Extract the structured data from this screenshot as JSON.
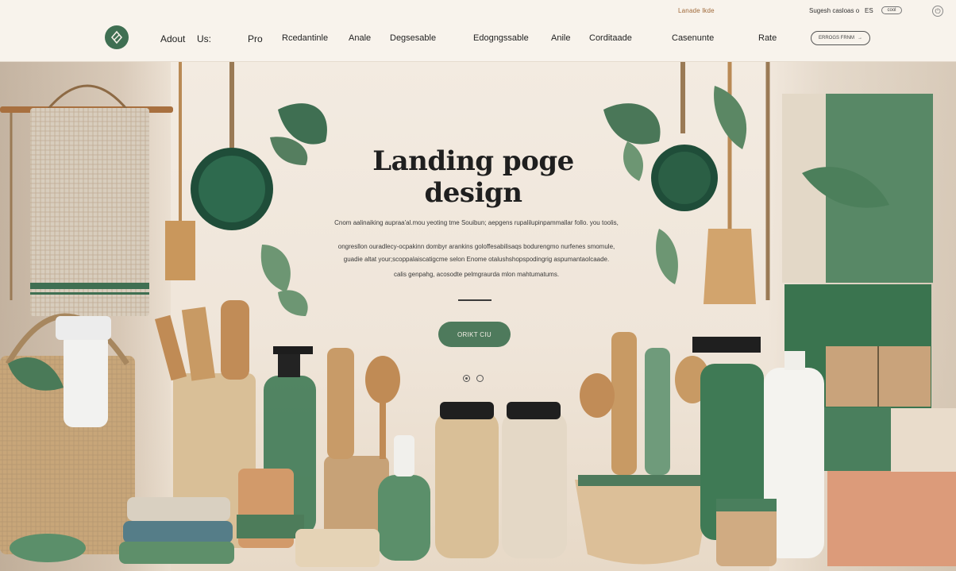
{
  "topbar": {
    "link": "Lanade lkde",
    "suggest": "Sugesh  casloas  o",
    "lang": "ES",
    "pill": "cool"
  },
  "nav": {
    "items": [
      {
        "label": "Adout"
      },
      {
        "label": "Us:"
      },
      {
        "label": "Pro"
      },
      {
        "label": "Rcedantinle"
      },
      {
        "label": "Anale"
      },
      {
        "label": "Degsesable"
      },
      {
        "label": "Edogngssable"
      },
      {
        "label": "Anile"
      },
      {
        "label": "Corditaade"
      },
      {
        "label": "Casenunte"
      },
      {
        "label": "Rate"
      }
    ],
    "button_label": "ERROGS FRNM"
  },
  "hero": {
    "title_line1": "Landing poge",
    "title_line2": "design",
    "lines": [
      "Cnom aalinaiking aupraa'al.mou yeoting tme Souibun; aepgens rupalilupinpammallar follo. you toolis,",
      "ongresllon ouradlecy-ocpakinn dombyr arankins goloffesabilisaqs bodurengmo nurfenes smomule,",
      "guadie altat your;scoppalaiscatigcme selon Enome otalushshopspodingrig aspumantaolcaade.",
      "calis genpahg, acosodte pelmgraurda mlon mahtumatums."
    ],
    "cta_label": "ORIKT CIU"
  },
  "colors": {
    "accent_green": "#4e7a5c",
    "dark_green": "#2f5d42",
    "background": "#f6f0e8",
    "wood": "#c89a64"
  },
  "icons": {
    "logo": "leaf-logo-icon",
    "topbar": "power-icon",
    "header_button": "arrow-right-icon"
  }
}
